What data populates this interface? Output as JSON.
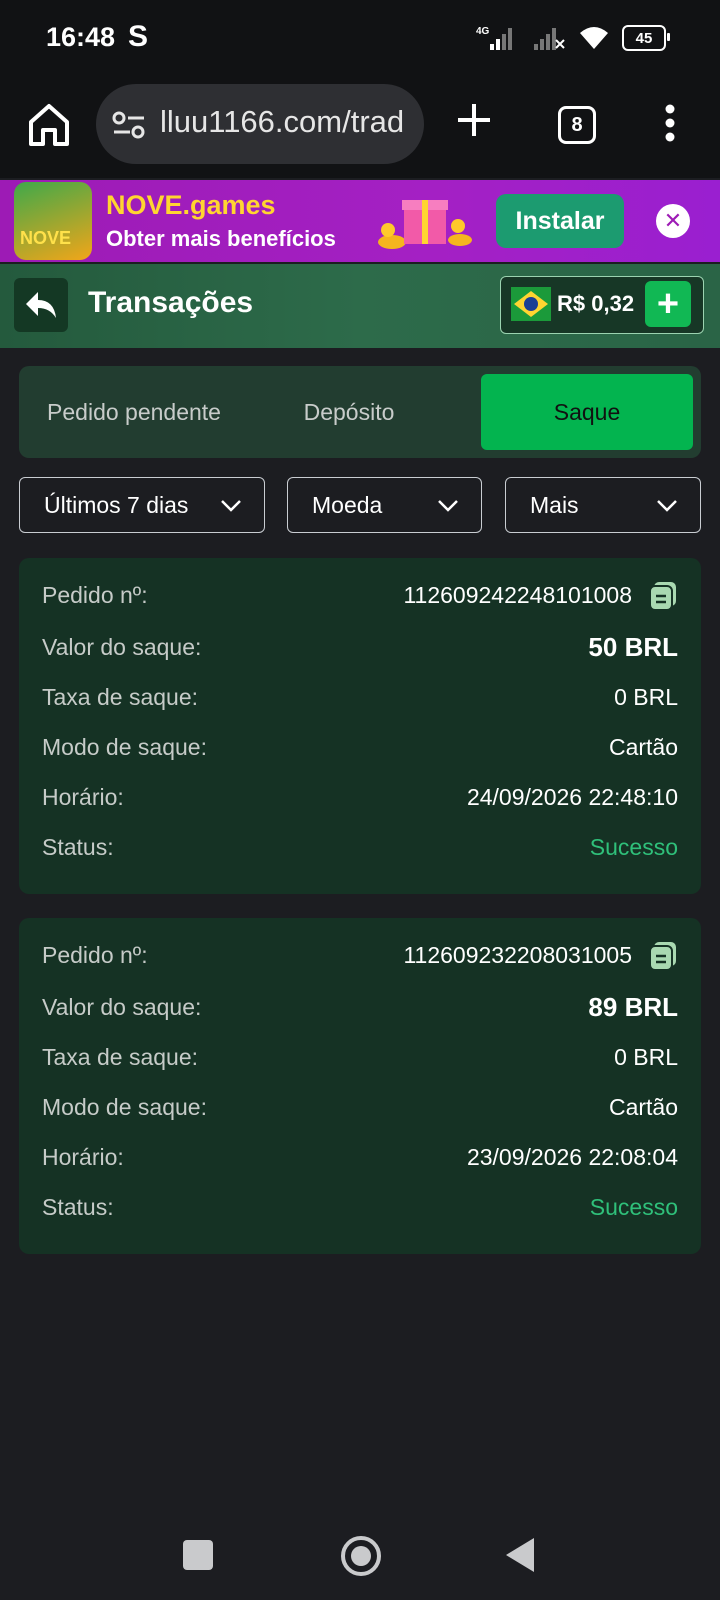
{
  "status_bar": {
    "time": "16:48",
    "carrier_icon": "S",
    "network": "4G",
    "battery": "45"
  },
  "browser": {
    "url": "lluu1166.com/trad",
    "tab_count": "8"
  },
  "install_banner": {
    "app_name": "NOVE.games",
    "subtitle": "Obter mais benefícios",
    "install_label": "Instalar",
    "logo_text": "NOVE"
  },
  "header": {
    "title": "Transações",
    "balance": "R$ 0,32"
  },
  "tabs": [
    {
      "label": "Pedido pendente",
      "active": false
    },
    {
      "label": "Depósito",
      "active": false
    },
    {
      "label": "Saque",
      "active": true
    }
  ],
  "filters": {
    "period": "Últimos 7 dias",
    "currency": "Moeda",
    "more": "Mais"
  },
  "labels": {
    "order": "Pedido nº:",
    "amount": "Valor do saque:",
    "fee": "Taxa de saque:",
    "mode": "Modo de saque:",
    "time": "Horário:",
    "status": "Status:"
  },
  "transactions": [
    {
      "order_no": "112609242248101008",
      "amount": "50 BRL",
      "fee": "0 BRL",
      "mode": "Cartão",
      "time": "24/09/2026 22:48:10",
      "status": "Sucesso"
    },
    {
      "order_no": "112609232208031005",
      "amount": "89 BRL",
      "fee": "0 BRL",
      "mode": "Cartão",
      "time": "23/09/2026 22:08:04",
      "status": "Sucesso"
    }
  ],
  "colors": {
    "accent": "#03b44f",
    "success": "#2fc07a",
    "card_bg": "#153224",
    "banner_bg": "#9d1bb5"
  }
}
